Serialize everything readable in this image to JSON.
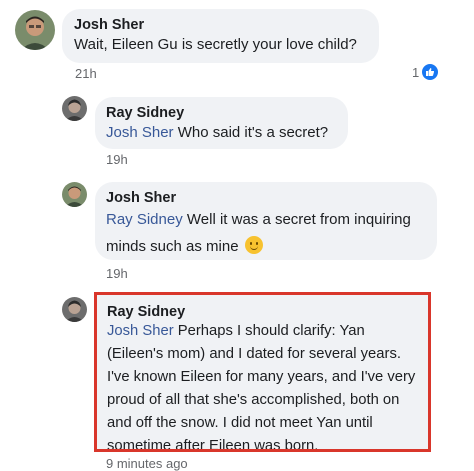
{
  "comments": [
    {
      "author": "Josh Sher",
      "text": "Wait, Eileen Gu is secretly your love child?",
      "time": "21h",
      "reaction_count": "1",
      "reaction_icon": "like-icon"
    },
    {
      "author": "Ray Sidney",
      "mention": "Josh Sher",
      "text": " Who said it's a secret?",
      "time": "19h"
    },
    {
      "author": "Josh Sher",
      "mention": "Ray Sidney",
      "text": " Well it was a secret from inquiring minds such as mine",
      "emoji": "smile-emoji",
      "time": "19h"
    },
    {
      "author": "Ray Sidney",
      "mention": "Josh Sher",
      "text": " Perhaps I should clarify: Yan (Eileen's mom) and I dated for several years. I've known Eileen for many years, and I've very proud of all that she's accomplished, both on and off the snow. I did not meet Yan until sometime after Eileen was born.",
      "time": "9 minutes ago",
      "highlighted": true,
      "highlight_color": "#d9362b"
    }
  ],
  "colors": {
    "bubble_bg": "#f0f2f5",
    "mention": "#385898",
    "like_blue": "#1877f2",
    "timestamp": "#65676b"
  }
}
